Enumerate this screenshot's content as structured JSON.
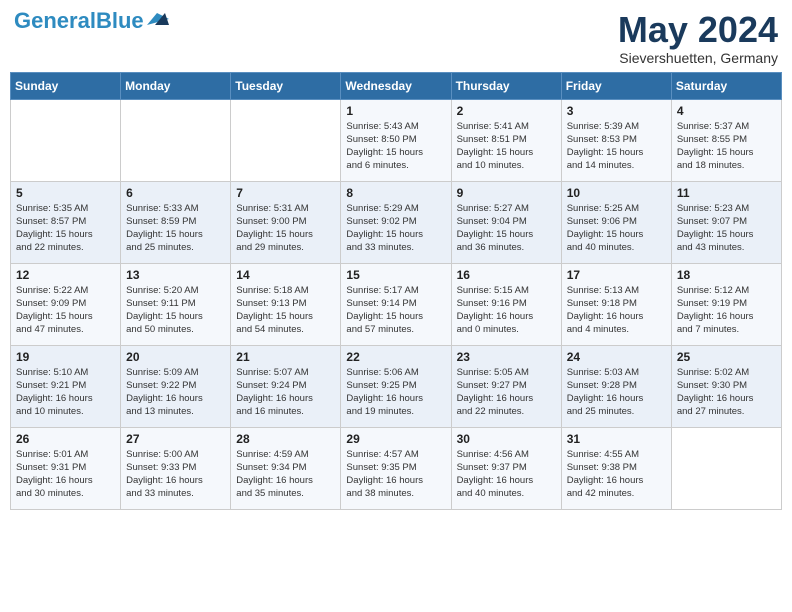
{
  "header": {
    "logo_general": "General",
    "logo_blue": "Blue",
    "month_title": "May 2024",
    "location": "Sievershuetten, Germany"
  },
  "days_of_week": [
    "Sunday",
    "Monday",
    "Tuesday",
    "Wednesday",
    "Thursday",
    "Friday",
    "Saturday"
  ],
  "weeks": [
    [
      {
        "day": "",
        "sunrise": "",
        "sunset": "",
        "daylight": ""
      },
      {
        "day": "",
        "sunrise": "",
        "sunset": "",
        "daylight": ""
      },
      {
        "day": "",
        "sunrise": "",
        "sunset": "",
        "daylight": ""
      },
      {
        "day": "1",
        "sunrise": "Sunrise: 5:43 AM",
        "sunset": "Sunset: 8:50 PM",
        "daylight": "Daylight: 15 hours and 6 minutes."
      },
      {
        "day": "2",
        "sunrise": "Sunrise: 5:41 AM",
        "sunset": "Sunset: 8:51 PM",
        "daylight": "Daylight: 15 hours and 10 minutes."
      },
      {
        "day": "3",
        "sunrise": "Sunrise: 5:39 AM",
        "sunset": "Sunset: 8:53 PM",
        "daylight": "Daylight: 15 hours and 14 minutes."
      },
      {
        "day": "4",
        "sunrise": "Sunrise: 5:37 AM",
        "sunset": "Sunset: 8:55 PM",
        "daylight": "Daylight: 15 hours and 18 minutes."
      }
    ],
    [
      {
        "day": "5",
        "sunrise": "Sunrise: 5:35 AM",
        "sunset": "Sunset: 8:57 PM",
        "daylight": "Daylight: 15 hours and 22 minutes."
      },
      {
        "day": "6",
        "sunrise": "Sunrise: 5:33 AM",
        "sunset": "Sunset: 8:59 PM",
        "daylight": "Daylight: 15 hours and 25 minutes."
      },
      {
        "day": "7",
        "sunrise": "Sunrise: 5:31 AM",
        "sunset": "Sunset: 9:00 PM",
        "daylight": "Daylight: 15 hours and 29 minutes."
      },
      {
        "day": "8",
        "sunrise": "Sunrise: 5:29 AM",
        "sunset": "Sunset: 9:02 PM",
        "daylight": "Daylight: 15 hours and 33 minutes."
      },
      {
        "day": "9",
        "sunrise": "Sunrise: 5:27 AM",
        "sunset": "Sunset: 9:04 PM",
        "daylight": "Daylight: 15 hours and 36 minutes."
      },
      {
        "day": "10",
        "sunrise": "Sunrise: 5:25 AM",
        "sunset": "Sunset: 9:06 PM",
        "daylight": "Daylight: 15 hours and 40 minutes."
      },
      {
        "day": "11",
        "sunrise": "Sunrise: 5:23 AM",
        "sunset": "Sunset: 9:07 PM",
        "daylight": "Daylight: 15 hours and 43 minutes."
      }
    ],
    [
      {
        "day": "12",
        "sunrise": "Sunrise: 5:22 AM",
        "sunset": "Sunset: 9:09 PM",
        "daylight": "Daylight: 15 hours and 47 minutes."
      },
      {
        "day": "13",
        "sunrise": "Sunrise: 5:20 AM",
        "sunset": "Sunset: 9:11 PM",
        "daylight": "Daylight: 15 hours and 50 minutes."
      },
      {
        "day": "14",
        "sunrise": "Sunrise: 5:18 AM",
        "sunset": "Sunset: 9:13 PM",
        "daylight": "Daylight: 15 hours and 54 minutes."
      },
      {
        "day": "15",
        "sunrise": "Sunrise: 5:17 AM",
        "sunset": "Sunset: 9:14 PM",
        "daylight": "Daylight: 15 hours and 57 minutes."
      },
      {
        "day": "16",
        "sunrise": "Sunrise: 5:15 AM",
        "sunset": "Sunset: 9:16 PM",
        "daylight": "Daylight: 16 hours and 0 minutes."
      },
      {
        "day": "17",
        "sunrise": "Sunrise: 5:13 AM",
        "sunset": "Sunset: 9:18 PM",
        "daylight": "Daylight: 16 hours and 4 minutes."
      },
      {
        "day": "18",
        "sunrise": "Sunrise: 5:12 AM",
        "sunset": "Sunset: 9:19 PM",
        "daylight": "Daylight: 16 hours and 7 minutes."
      }
    ],
    [
      {
        "day": "19",
        "sunrise": "Sunrise: 5:10 AM",
        "sunset": "Sunset: 9:21 PM",
        "daylight": "Daylight: 16 hours and 10 minutes."
      },
      {
        "day": "20",
        "sunrise": "Sunrise: 5:09 AM",
        "sunset": "Sunset: 9:22 PM",
        "daylight": "Daylight: 16 hours and 13 minutes."
      },
      {
        "day": "21",
        "sunrise": "Sunrise: 5:07 AM",
        "sunset": "Sunset: 9:24 PM",
        "daylight": "Daylight: 16 hours and 16 minutes."
      },
      {
        "day": "22",
        "sunrise": "Sunrise: 5:06 AM",
        "sunset": "Sunset: 9:25 PM",
        "daylight": "Daylight: 16 hours and 19 minutes."
      },
      {
        "day": "23",
        "sunrise": "Sunrise: 5:05 AM",
        "sunset": "Sunset: 9:27 PM",
        "daylight": "Daylight: 16 hours and 22 minutes."
      },
      {
        "day": "24",
        "sunrise": "Sunrise: 5:03 AM",
        "sunset": "Sunset: 9:28 PM",
        "daylight": "Daylight: 16 hours and 25 minutes."
      },
      {
        "day": "25",
        "sunrise": "Sunrise: 5:02 AM",
        "sunset": "Sunset: 9:30 PM",
        "daylight": "Daylight: 16 hours and 27 minutes."
      }
    ],
    [
      {
        "day": "26",
        "sunrise": "Sunrise: 5:01 AM",
        "sunset": "Sunset: 9:31 PM",
        "daylight": "Daylight: 16 hours and 30 minutes."
      },
      {
        "day": "27",
        "sunrise": "Sunrise: 5:00 AM",
        "sunset": "Sunset: 9:33 PM",
        "daylight": "Daylight: 16 hours and 33 minutes."
      },
      {
        "day": "28",
        "sunrise": "Sunrise: 4:59 AM",
        "sunset": "Sunset: 9:34 PM",
        "daylight": "Daylight: 16 hours and 35 minutes."
      },
      {
        "day": "29",
        "sunrise": "Sunrise: 4:57 AM",
        "sunset": "Sunset: 9:35 PM",
        "daylight": "Daylight: 16 hours and 38 minutes."
      },
      {
        "day": "30",
        "sunrise": "Sunrise: 4:56 AM",
        "sunset": "Sunset: 9:37 PM",
        "daylight": "Daylight: 16 hours and 40 minutes."
      },
      {
        "day": "31",
        "sunrise": "Sunrise: 4:55 AM",
        "sunset": "Sunset: 9:38 PM",
        "daylight": "Daylight: 16 hours and 42 minutes."
      },
      {
        "day": "",
        "sunrise": "",
        "sunset": "",
        "daylight": ""
      }
    ]
  ]
}
